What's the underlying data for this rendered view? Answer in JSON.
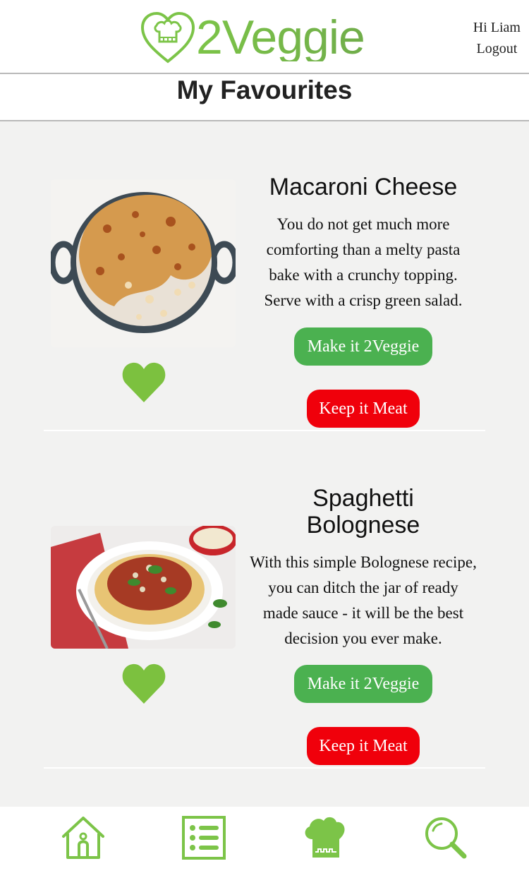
{
  "header": {
    "logo_text": "2Veggie",
    "greeting": "Hi Liam",
    "logout_label": "Logout"
  },
  "page": {
    "title": "My Favourites"
  },
  "recipes": [
    {
      "title": "Macaroni Cheese",
      "description": "You do not get much more comforting than a melty pasta bake with a crunchy topping. Serve with a crisp green salad.",
      "veggie_label": "Make it 2Veggie",
      "meat_label": "Keep it Meat",
      "favourite_icon": "heart-icon"
    },
    {
      "title": "Spaghetti Bolognese",
      "description": "With this simple Bolognese recipe, you can ditch the jar of ready made sauce - it will be the best decision you ever make.",
      "veggie_label": "Make it 2Veggie",
      "meat_label": "Keep it Meat",
      "favourite_icon": "heart-icon"
    }
  ],
  "nav": [
    {
      "icon": "home-icon"
    },
    {
      "icon": "list-icon"
    },
    {
      "icon": "chef-hat-icon"
    },
    {
      "icon": "search-icon"
    }
  ],
  "colors": {
    "brand_green": "#7cc448",
    "veggie_button": "#4bb150",
    "meat_button": "#f0000b",
    "background": "#f2f2f1"
  }
}
